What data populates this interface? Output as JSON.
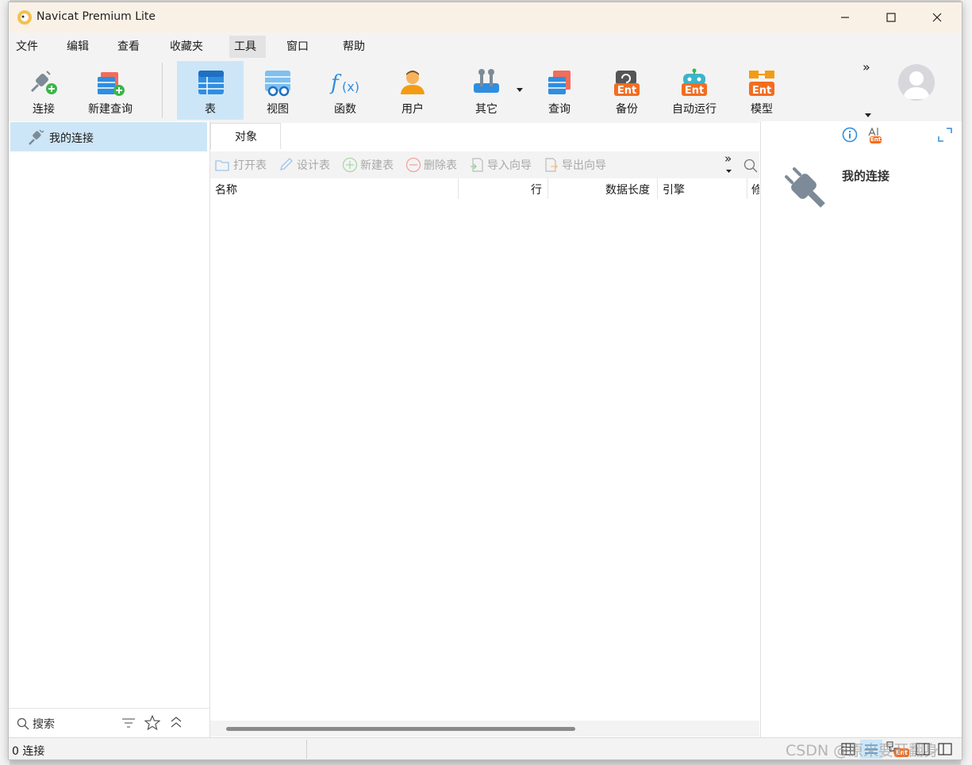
{
  "window": {
    "title": "Navicat Premium Lite"
  },
  "menu": [
    "文件",
    "编辑",
    "查看",
    "收藏夹",
    "工具",
    "窗口",
    "帮助"
  ],
  "toolbar": {
    "connect": "连接",
    "new_query": "新建查询",
    "table": "表",
    "view": "视图",
    "function": "函数",
    "user": "用户",
    "others": "其它",
    "query": "查询",
    "backup": "备份",
    "automation": "自动运行",
    "model": "模型",
    "overflow": "»",
    "ent_label": "Ent"
  },
  "sidebar": {
    "connection_name": "我的连接",
    "search_placeholder": "搜索"
  },
  "center": {
    "tab_objects": "对象",
    "actions": {
      "open_table": "打开表",
      "design_table": "设计表",
      "new_table": "新建表",
      "delete_table": "删除表",
      "import_wizard": "导入向导",
      "export_wizard": "导出向导"
    },
    "columns": [
      "名称",
      "行",
      "数据长度",
      "引擎",
      "修"
    ]
  },
  "right_panel": {
    "title": "我的连接"
  },
  "status": {
    "connections": "0 连接"
  },
  "watermark": "CSDN @原来要开翻身",
  "colors": {
    "accent_selected": "#cde6f7",
    "title_bar": "#faf1e6",
    "ent_orange": "#f26d21"
  }
}
